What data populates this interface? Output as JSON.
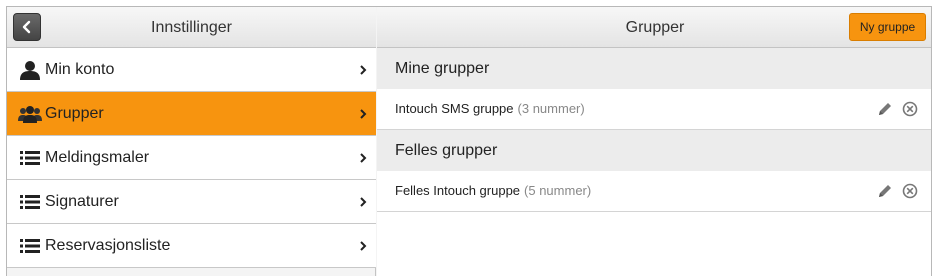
{
  "sidebar": {
    "title": "Innstillinger",
    "items": [
      {
        "label": "Min konto",
        "icon": "person-icon",
        "active": false
      },
      {
        "label": "Grupper",
        "icon": "group-icon",
        "active": true
      },
      {
        "label": "Meldingsmaler",
        "icon": "list-icon",
        "active": false
      },
      {
        "label": "Signaturer",
        "icon": "list-icon",
        "active": false
      },
      {
        "label": "Reservasjonsliste",
        "icon": "list-icon",
        "active": false
      }
    ]
  },
  "main": {
    "title": "Grupper",
    "new_button_label": "Ny gruppe",
    "sections": [
      {
        "title": "Mine grupper",
        "groups": [
          {
            "name": "Intouch SMS gruppe",
            "count": "(3 nummer)"
          }
        ]
      },
      {
        "title": "Felles grupper",
        "groups": [
          {
            "name": "Felles Intouch gruppe",
            "count": "(5 nummer)"
          }
        ]
      }
    ]
  },
  "colors": {
    "accent": "#f7940f",
    "header_bg": "#ececec"
  }
}
